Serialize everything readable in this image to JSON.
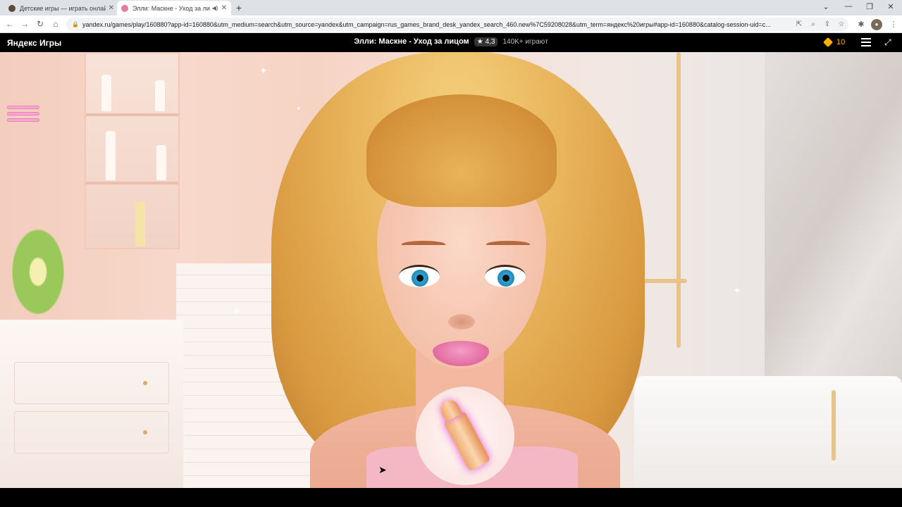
{
  "tabs": [
    {
      "title": "Детские игры — играть онлайн",
      "active": false
    },
    {
      "title": "Элли: Маскне - Уход за лиц",
      "active": true
    }
  ],
  "address": {
    "url": "yandex.ru/games/play/160880?app-id=160880&utm_medium=search&utm_source=yandex&utm_campaign=rus_games_brand_desk_yandex_search_460.new%7C59208028&utm_term=яндекс%20игры#app-id=160880&catalog-session-uid=c..."
  },
  "header": {
    "brand": "Яндекс Игры",
    "game_title": "Элли: Маскне - Уход за лицом",
    "rating": "★ 4,3",
    "players": "140K+ играют",
    "coins": "10"
  },
  "colors": {
    "accent_coin": "#ffb200",
    "game_menu": "#f7a8d0",
    "lipstick_glow": "#e45bd8"
  },
  "icons": {
    "tab1_favicon": "yandex-favicon",
    "tab2_favicon": "game-favicon",
    "tool": "lipstick-icon",
    "heart": "heart-icon"
  }
}
